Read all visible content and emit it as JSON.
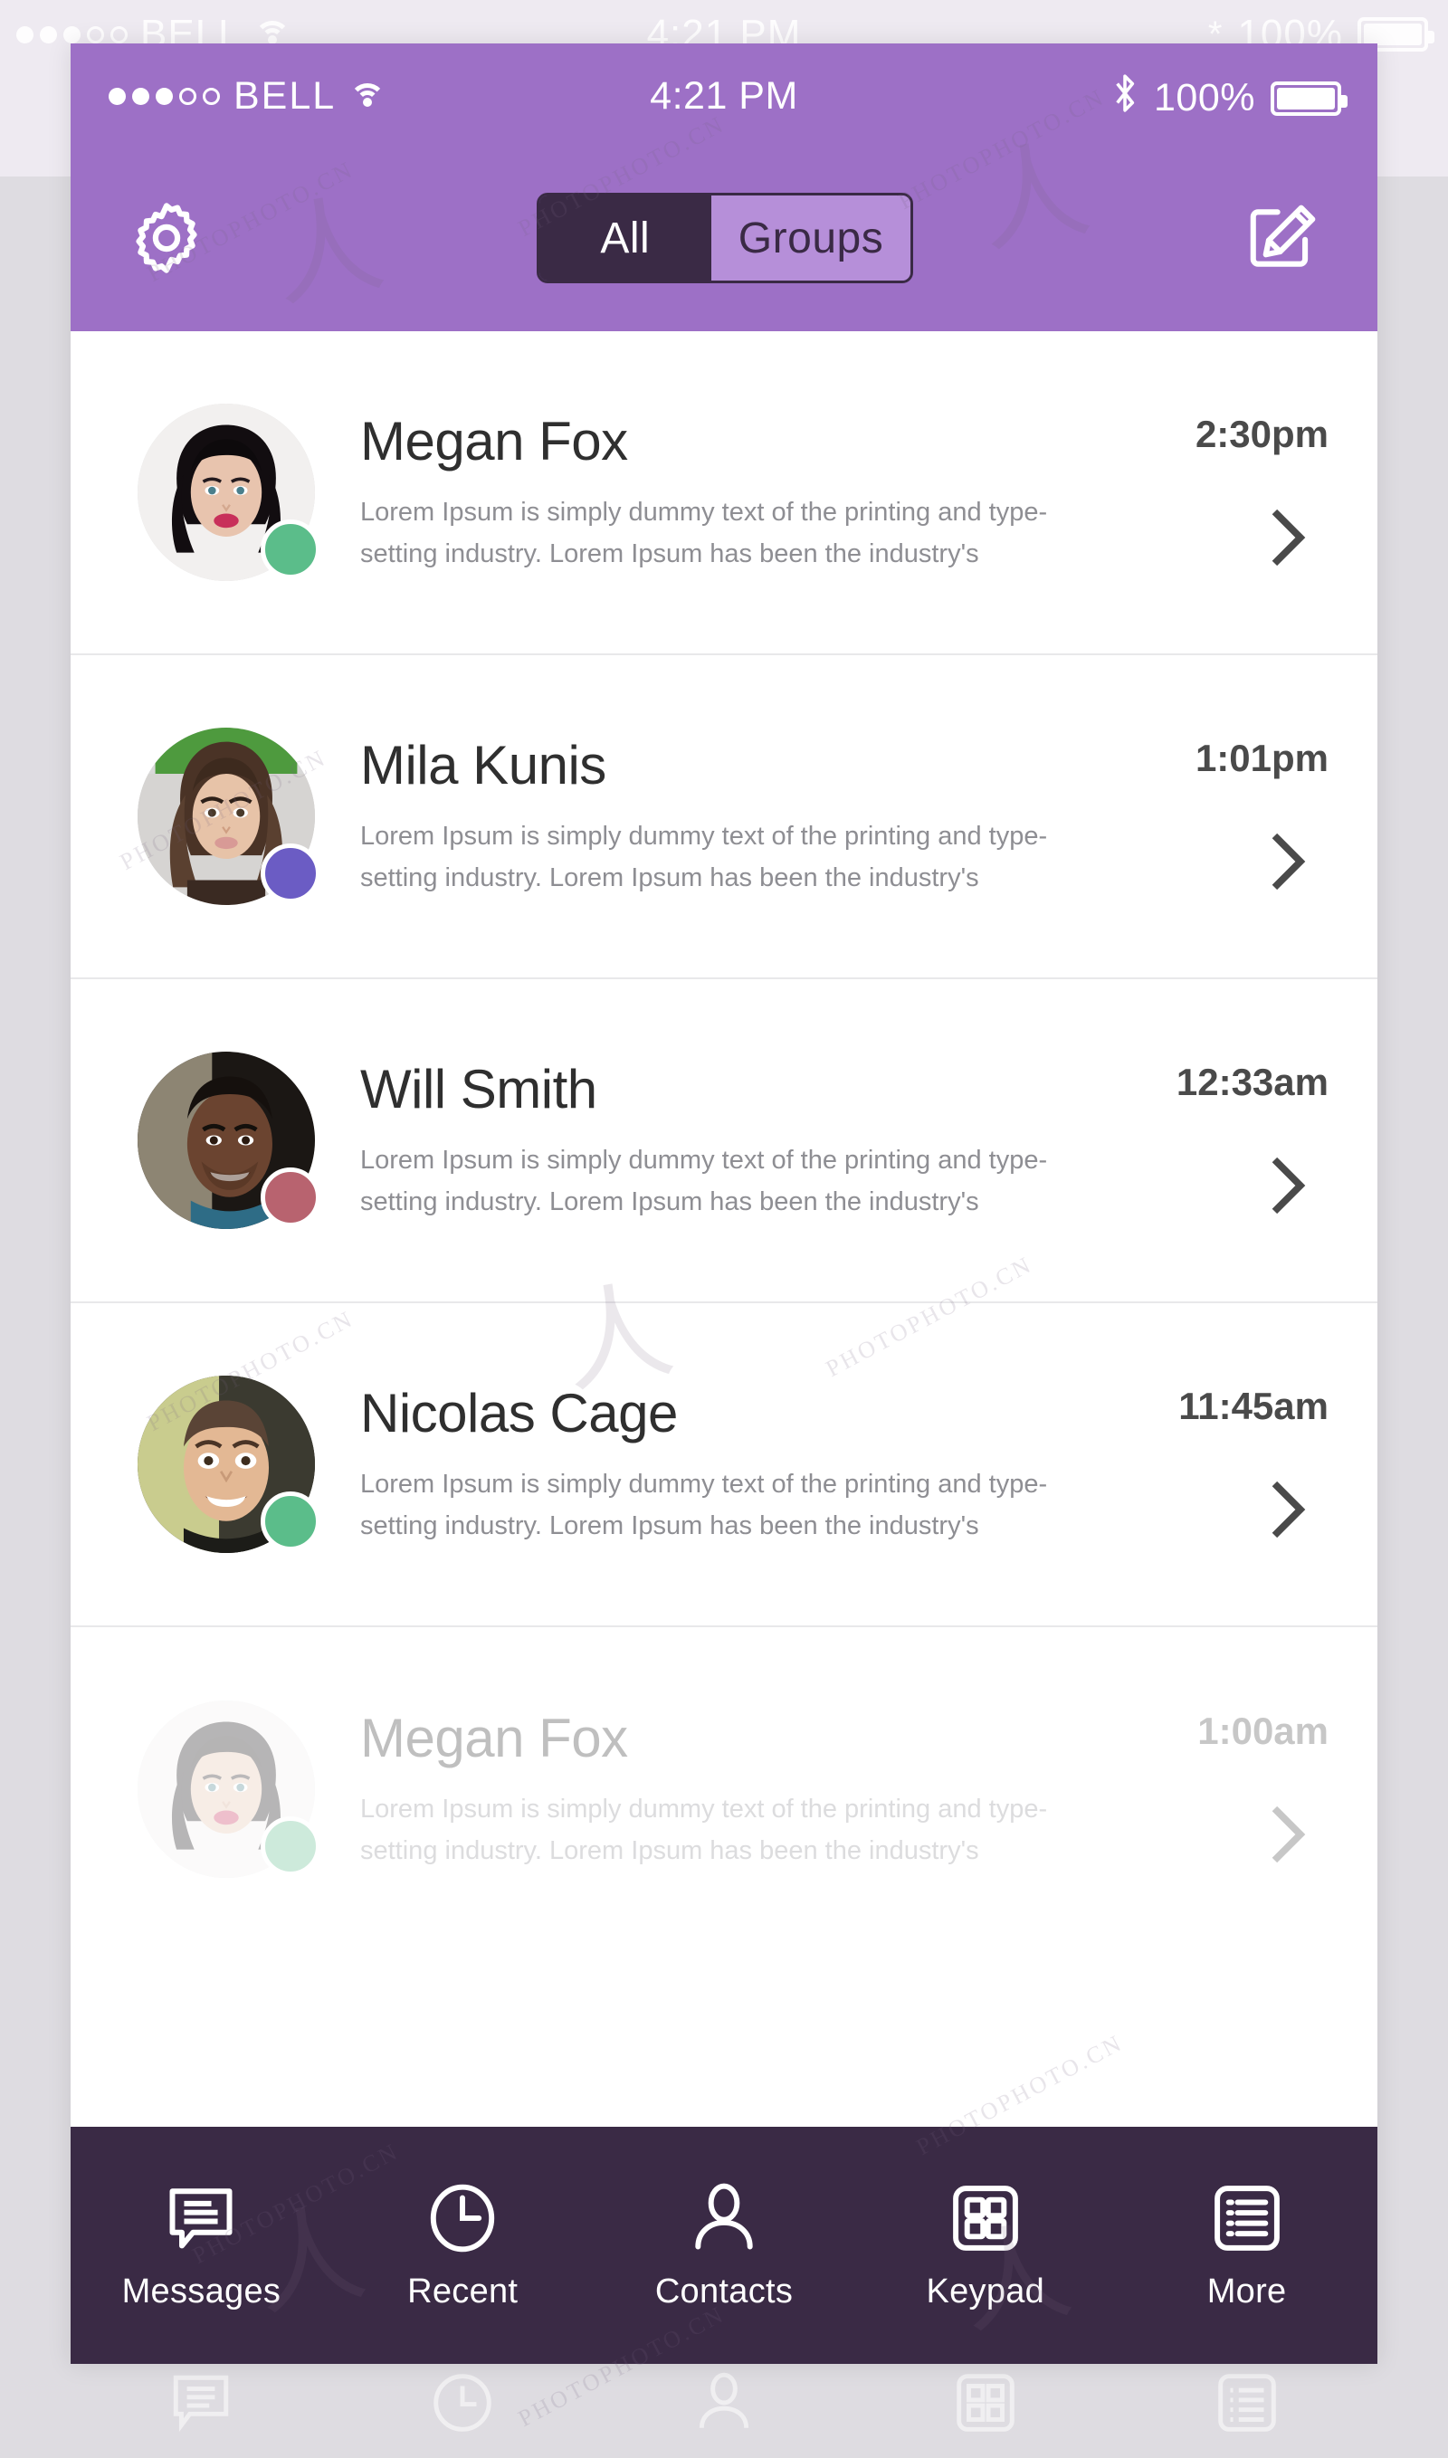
{
  "theme": {
    "header_purple": "#9d70c6",
    "dark_purple": "#3a2a45",
    "segment_inactive": "#b68fd9",
    "panel_bg": "#ffffff",
    "page_bg": "#e4e2e6"
  },
  "status_bar": {
    "signal_filled_dots": 3,
    "signal_empty_dots": 2,
    "carrier": "BELL",
    "wifi_icon": "wifi-icon",
    "time": "4:21 PM",
    "bluetooth_icon": "bluetooth-icon",
    "battery_percent": "100%",
    "battery_icon": "battery-full-icon"
  },
  "nav": {
    "settings_icon": "gear-icon",
    "compose_icon": "compose-pencil-icon",
    "segments": [
      {
        "label": "All",
        "selected": true
      },
      {
        "label": "Groups",
        "selected": false
      }
    ]
  },
  "conversations": [
    {
      "name": "Megan Fox",
      "preview": "Lorem Ipsum is simply dummy text of the printing and type-setting industry. Lorem Ipsum has been the industry's",
      "time": "2:30pm",
      "status_color": "#5bbd8a",
      "status_label": "online",
      "chevron_icon": "chevron-right-icon",
      "faded": false
    },
    {
      "name": "Mila Kunis",
      "preview": "Lorem Ipsum is simply dummy text of the printing and type-setting industry. Lorem Ipsum has been the industry's",
      "time": "1:01pm",
      "status_color": "#6b5cc4",
      "status_label": "busy",
      "chevron_icon": "chevron-right-icon",
      "faded": false
    },
    {
      "name": "Will Smith",
      "preview": "Lorem Ipsum is simply dummy text of the printing and type-setting industry. Lorem Ipsum has been the industry's",
      "time": "12:33am",
      "status_color": "#b8636f",
      "status_label": "away",
      "chevron_icon": "chevron-right-icon",
      "faded": false
    },
    {
      "name": "Nicolas Cage",
      "preview": "Lorem Ipsum is simply dummy text of the printing and type-setting industry. Lorem Ipsum has been the industry's",
      "time": "11:45am",
      "status_color": "#5bbd8a",
      "status_label": "online",
      "chevron_icon": "chevron-right-icon",
      "faded": false
    },
    {
      "name": "Megan Fox",
      "preview": "Lorem Ipsum is simply dummy text of the printing and type-setting industry. Lorem Ipsum has been the industry's",
      "time": "1:00am",
      "status_color": "#5bbd8a",
      "status_label": "online",
      "chevron_icon": "chevron-right-icon",
      "faded": true
    }
  ],
  "tabbar": {
    "items": [
      {
        "label": "Messages",
        "icon": "message-bubble-icon",
        "active": true
      },
      {
        "label": "Recent",
        "icon": "clock-icon",
        "active": false
      },
      {
        "label": "Contacts",
        "icon": "person-icon",
        "active": false
      },
      {
        "label": "Keypad",
        "icon": "grid-squares-icon",
        "active": false
      },
      {
        "label": "More",
        "icon": "list-icon",
        "active": false
      }
    ]
  },
  "watermarks": {
    "text": "PHOTOPHOTO.CN"
  }
}
